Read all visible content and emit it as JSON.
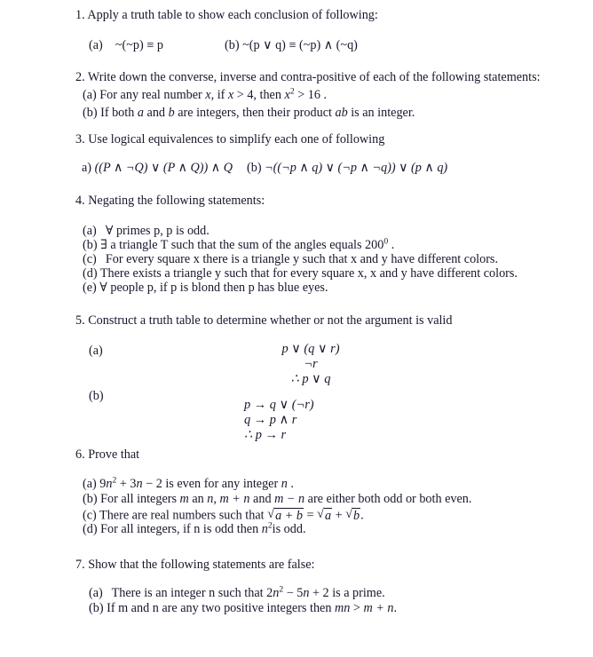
{
  "document": {
    "type": "math-worksheet",
    "subject": "Discrete Mathematics / Logic problem set",
    "background_color": "#ffffff",
    "text_color": "#16182c"
  },
  "questions": [
    {
      "number": "1.",
      "heading": "1. Apply a truth table to show each conclusion of following:",
      "parts": [
        {
          "label": "(a)",
          "text": "~(~p) ≡ p"
        },
        {
          "label": "(b)",
          "text": "~(p ∨ q)  ≡ (~p) ∧ (~q)"
        }
      ]
    },
    {
      "number": "2.",
      "heading": "2. Write down the converse, inverse and contra-positive of each of the following statements:",
      "parts": [
        {
          "label": "(a)",
          "text_pre": "For any real number ",
          "var1": "x",
          "text_mid": ", if ",
          "var2": "x",
          "rel1": " > 4,",
          "text_mid2": " then ",
          "var3": "x",
          "power": "2",
          "rel2": " > 16 ."
        },
        {
          "label": "(b)",
          "text_pre": "If both ",
          "var1": "a",
          "text_mid": " and ",
          "var2": "b",
          "text_mid2": " are integers, then their product ",
          "var3": "ab",
          "text_post": " is an integer."
        }
      ]
    },
    {
      "number": "3.",
      "heading": "3. Use logical equivalences to simplify each one of following",
      "parts": [
        {
          "label": "a)",
          "text": "((P ∧ ¬Q) ∨ (P ∧ Q)) ∧ Q"
        },
        {
          "label": "(b)",
          "text": "¬((¬p ∧ q) ∨ (¬p ∧ ¬q)) ∨ (p ∧ q)"
        }
      ]
    },
    {
      "number": "4.",
      "heading": "4. Negating the following statements:",
      "parts": [
        {
          "label": "(a)",
          "text": "∀ primes p, p is odd."
        },
        {
          "label": "(b)",
          "text_pre": "∃ a triangle T such that the sum of the angles equals ",
          "value": "200",
          "degree": "0",
          "text_post": " ."
        },
        {
          "label": "(c)",
          "text": "For every square x there is a triangle y such that x and y have different colors."
        },
        {
          "label": "(d)",
          "text": "There exists a triangle y such that for every square x, x and y have different colors."
        },
        {
          "label": "(e)",
          "text": "∀ people p, if p is blond then p has blue eyes."
        }
      ]
    },
    {
      "number": "5.",
      "heading": "5. Construct a truth table to determine whether or not the argument is valid",
      "parts": [
        {
          "label": "(a)",
          "argument": [
            "p ∨ (q ∨ r)",
            "¬r",
            "∴ p ∨ q"
          ]
        },
        {
          "label": "(b)",
          "argument": [
            "p → q ∨ (¬r)",
            "q → p ∧ r",
            "∴ p → r"
          ]
        }
      ]
    },
    {
      "number": "6.",
      "heading": "6. Prove that",
      "parts": [
        {
          "label": "(a)",
          "expr_lead": "9",
          "v1": "n",
          "p1": "2",
          "mid1": " + 3",
          "v2": "n",
          "mid2": " − 2",
          "text_post": " is even for any integer ",
          "v3": "n",
          "tail": " ."
        },
        {
          "label": "(b)",
          "text_pre": "For all integers ",
          "v1": "m",
          "mid1": " an ",
          "v2": "n",
          "mid2": ", ",
          "e1": "m + n",
          "mid3": " and ",
          "e2": "m − n",
          "text_post": " are either both odd or both even."
        },
        {
          "label": "(c)",
          "text_pre": "There are real numbers such that ",
          "rad1": "a + b",
          "eq": " = ",
          "rad2": "a",
          "plus": " + ",
          "rad3": "b",
          "text_post": "."
        },
        {
          "label": "(d)",
          "text_pre": "For all integers, if n is odd then ",
          "v1": "n",
          "p1": "2",
          "text_post": "is odd."
        }
      ]
    },
    {
      "number": "7.",
      "heading": "7. Show that the following statements are false:",
      "parts": [
        {
          "label": "(a)",
          "text_pre": "There is an integer n such that ",
          "expr_lead": "2",
          "v1": "n",
          "p1": "2",
          "mid1": " − 5",
          "v2": "n",
          "mid2": " + 2",
          "text_post": " is a prime."
        },
        {
          "label": "(b)",
          "text_pre": "If m and n are any two positive integers then ",
          "e1": "mn",
          "gt": " > ",
          "e2": "m + n",
          "text_post": "."
        }
      ]
    }
  ]
}
